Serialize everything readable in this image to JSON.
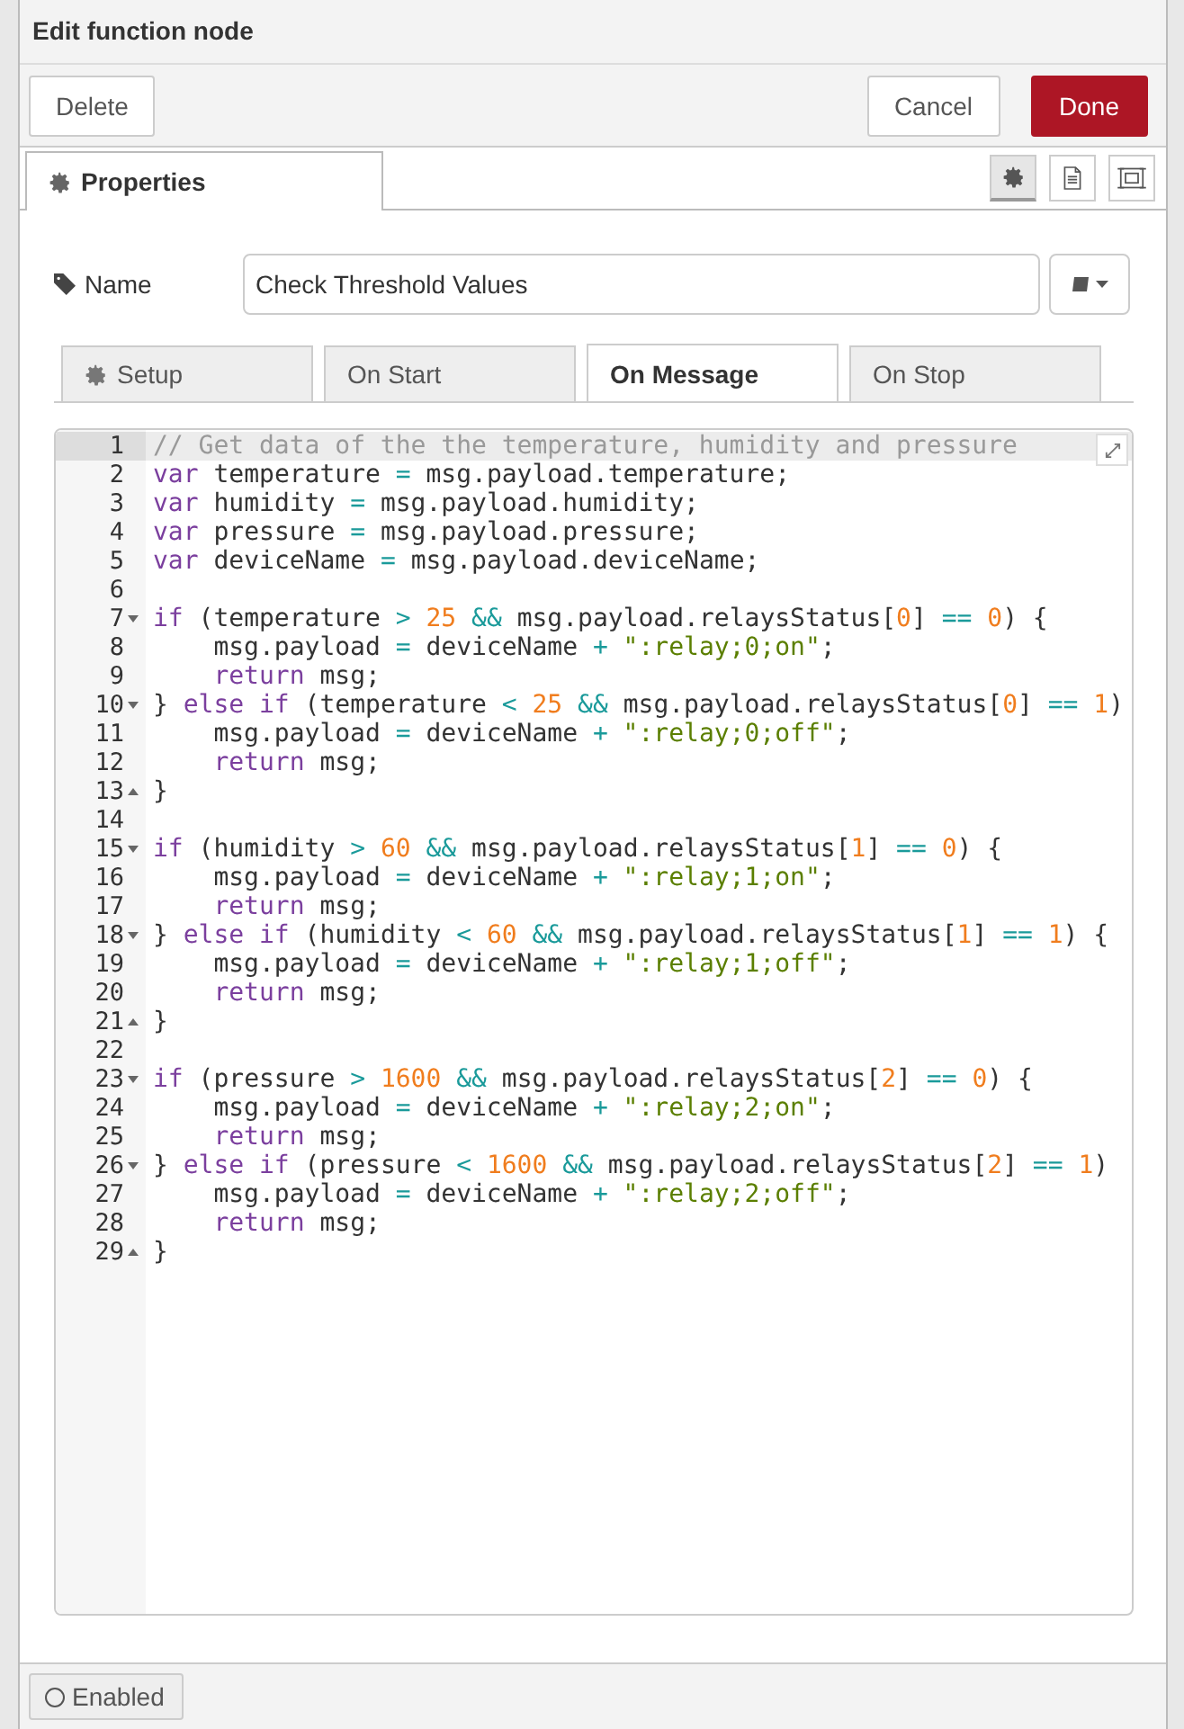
{
  "window": {
    "title": "Edit function node"
  },
  "toolbar": {
    "buttons": [
      {
        "label": "Delete",
        "kind": "plain"
      },
      {
        "label": "Cancel",
        "kind": "plain"
      },
      {
        "label": "Done",
        "kind": "primary"
      }
    ]
  },
  "tabs": [
    {
      "label": "Properties",
      "selected": true
    }
  ],
  "tab_icons": [
    {
      "kind": "gear",
      "selected": true
    },
    {
      "kind": "document",
      "selected": false
    },
    {
      "kind": "frame",
      "selected": false
    }
  ],
  "name_field": {
    "label": "Name",
    "value": "Check Threshold Values"
  },
  "code_tabs": [
    {
      "label": "Setup",
      "selected": false
    },
    {
      "label": "On Start",
      "selected": false
    },
    {
      "label": "On Message",
      "selected": true
    },
    {
      "label": "On Stop",
      "selected": false
    }
  ],
  "editor": {
    "lines": [
      {
        "number": "1",
        "active": true,
        "tokens": [
          {
            "kind": "comment",
            "text": "// Get data of the the temperature, humidity and pressure"
          }
        ]
      },
      {
        "number": "2",
        "active": false,
        "tokens": [
          {
            "kind": "keyword",
            "text": "var"
          },
          {
            "kind": "plain",
            "text": " temperature "
          },
          {
            "kind": "operator",
            "text": "= "
          },
          {
            "kind": "plain",
            "text": "msg.payload.temperature;"
          }
        ]
      },
      {
        "number": "3",
        "active": false,
        "tokens": [
          {
            "kind": "keyword",
            "text": "var"
          },
          {
            "kind": "plain",
            "text": " humidity "
          },
          {
            "kind": "operator",
            "text": "= "
          },
          {
            "kind": "plain",
            "text": "msg.payload.humidity;"
          }
        ]
      },
      {
        "number": "4",
        "active": false,
        "tokens": [
          {
            "kind": "keyword",
            "text": "var"
          },
          {
            "kind": "plain",
            "text": " pressure "
          },
          {
            "kind": "operator",
            "text": "= "
          },
          {
            "kind": "plain",
            "text": "msg.payload.pressure;"
          }
        ]
      },
      {
        "number": "5",
        "active": false,
        "tokens": [
          {
            "kind": "keyword",
            "text": "var"
          },
          {
            "kind": "plain",
            "text": " deviceName "
          },
          {
            "kind": "operator",
            "text": "= "
          },
          {
            "kind": "plain",
            "text": "msg.payload.deviceName;"
          }
        ]
      },
      {
        "number": "6",
        "active": false
      },
      {
        "number": "7",
        "active": false,
        "fold_start": true,
        "tokens": [
          {
            "kind": "keyword",
            "text": "if"
          },
          {
            "kind": "plain",
            "text": " (temperature "
          },
          {
            "kind": "operator",
            "text": "> "
          },
          {
            "kind": "number",
            "text": "25 "
          },
          {
            "kind": "operator",
            "text": "&& "
          },
          {
            "kind": "plain",
            "text": "msg.payload.relaysStatus["
          },
          {
            "kind": "number",
            "text": "0"
          },
          {
            "kind": "plain",
            "text": "] "
          },
          {
            "kind": "operator",
            "text": "== "
          },
          {
            "kind": "number",
            "text": "0"
          },
          {
            "kind": "plain",
            "text": ") {"
          }
        ]
      },
      {
        "number": "8",
        "active": false,
        "indented": true,
        "tokens": [
          {
            "kind": "plain",
            "text": "msg.payload "
          },
          {
            "kind": "operator",
            "text": "= "
          },
          {
            "kind": "plain",
            "text": "deviceName "
          },
          {
            "kind": "operator",
            "text": "+ "
          },
          {
            "kind": "string",
            "text": "\":relay;0;on\""
          },
          {
            "kind": "plain",
            "text": ";"
          }
        ]
      },
      {
        "number": "9",
        "active": false,
        "indented": true,
        "tokens": [
          {
            "kind": "keyword",
            "text": "return"
          },
          {
            "kind": "plain",
            "text": " msg;"
          }
        ]
      },
      {
        "number": "10",
        "active": false,
        "fold_start": true,
        "tokens": [
          {
            "kind": "plain",
            "text": "} "
          },
          {
            "kind": "keyword",
            "text": "else if"
          },
          {
            "kind": "plain",
            "text": " (temperature "
          },
          {
            "kind": "operator",
            "text": "< "
          },
          {
            "kind": "number",
            "text": "25 "
          },
          {
            "kind": "operator",
            "text": "&& "
          },
          {
            "kind": "plain",
            "text": "msg.payload.relaysStatus["
          },
          {
            "kind": "number",
            "text": "0"
          },
          {
            "kind": "plain",
            "text": "] "
          },
          {
            "kind": "operator",
            "text": "== "
          },
          {
            "kind": "number",
            "text": "1"
          },
          {
            "kind": "plain",
            "text": ")"
          }
        ]
      },
      {
        "number": "11",
        "active": false,
        "indented": true,
        "tokens": [
          {
            "kind": "plain",
            "text": "msg.payload "
          },
          {
            "kind": "operator",
            "text": "= "
          },
          {
            "kind": "plain",
            "text": "deviceName "
          },
          {
            "kind": "operator",
            "text": "+ "
          },
          {
            "kind": "string",
            "text": "\":relay;0;off\""
          },
          {
            "kind": "plain",
            "text": ";"
          }
        ]
      },
      {
        "number": "12",
        "active": false,
        "indented": true,
        "tokens": [
          {
            "kind": "keyword",
            "text": "return"
          },
          {
            "kind": "plain",
            "text": " msg;"
          }
        ]
      },
      {
        "number": "13",
        "active": false,
        "fold_end": true,
        "tokens": [
          {
            "kind": "plain",
            "text": "}"
          }
        ]
      },
      {
        "number": "14",
        "active": false
      },
      {
        "number": "15",
        "active": false,
        "fold_start": true,
        "tokens": [
          {
            "kind": "keyword",
            "text": "if"
          },
          {
            "kind": "plain",
            "text": " (humidity "
          },
          {
            "kind": "operator",
            "text": "> "
          },
          {
            "kind": "number",
            "text": "60 "
          },
          {
            "kind": "operator",
            "text": "&& "
          },
          {
            "kind": "plain",
            "text": "msg.payload.relaysStatus["
          },
          {
            "kind": "number",
            "text": "1"
          },
          {
            "kind": "plain",
            "text": "] "
          },
          {
            "kind": "operator",
            "text": "== "
          },
          {
            "kind": "number",
            "text": "0"
          },
          {
            "kind": "plain",
            "text": ") {"
          }
        ]
      },
      {
        "number": "16",
        "active": false,
        "indented": true,
        "tokens": [
          {
            "kind": "plain",
            "text": "msg.payload "
          },
          {
            "kind": "operator",
            "text": "= "
          },
          {
            "kind": "plain",
            "text": "deviceName "
          },
          {
            "kind": "operator",
            "text": "+ "
          },
          {
            "kind": "string",
            "text": "\":relay;1;on\""
          },
          {
            "kind": "plain",
            "text": ";"
          }
        ]
      },
      {
        "number": "17",
        "active": false,
        "indented": true,
        "tokens": [
          {
            "kind": "keyword",
            "text": "return"
          },
          {
            "kind": "plain",
            "text": " msg;"
          }
        ]
      },
      {
        "number": "18",
        "active": false,
        "fold_start": true,
        "tokens": [
          {
            "kind": "plain",
            "text": "} "
          },
          {
            "kind": "keyword",
            "text": "else if"
          },
          {
            "kind": "plain",
            "text": " (humidity "
          },
          {
            "kind": "operator",
            "text": "< "
          },
          {
            "kind": "number",
            "text": "60 "
          },
          {
            "kind": "operator",
            "text": "&& "
          },
          {
            "kind": "plain",
            "text": "msg.payload.relaysStatus["
          },
          {
            "kind": "number",
            "text": "1"
          },
          {
            "kind": "plain",
            "text": "] "
          },
          {
            "kind": "operator",
            "text": "== "
          },
          {
            "kind": "number",
            "text": "1"
          },
          {
            "kind": "plain",
            "text": ") {"
          }
        ]
      },
      {
        "number": "19",
        "active": false,
        "indented": true,
        "tokens": [
          {
            "kind": "plain",
            "text": "msg.payload "
          },
          {
            "kind": "operator",
            "text": "= "
          },
          {
            "kind": "plain",
            "text": "deviceName "
          },
          {
            "kind": "operator",
            "text": "+ "
          },
          {
            "kind": "string",
            "text": "\":relay;1;off\""
          },
          {
            "kind": "plain",
            "text": ";"
          }
        ]
      },
      {
        "number": "20",
        "active": false,
        "indented": true,
        "tokens": [
          {
            "kind": "keyword",
            "text": "return"
          },
          {
            "kind": "plain",
            "text": " msg;"
          }
        ]
      },
      {
        "number": "21",
        "active": false,
        "fold_end": true,
        "tokens": [
          {
            "kind": "plain",
            "text": "}"
          }
        ]
      },
      {
        "number": "22",
        "active": false
      },
      {
        "number": "23",
        "active": false,
        "fold_start": true,
        "tokens": [
          {
            "kind": "keyword",
            "text": "if"
          },
          {
            "kind": "plain",
            "text": " (pressure "
          },
          {
            "kind": "operator",
            "text": "> "
          },
          {
            "kind": "number",
            "text": "1600 "
          },
          {
            "kind": "operator",
            "text": "&& "
          },
          {
            "kind": "plain",
            "text": "msg.payload.relaysStatus["
          },
          {
            "kind": "number",
            "text": "2"
          },
          {
            "kind": "plain",
            "text": "] "
          },
          {
            "kind": "operator",
            "text": "== "
          },
          {
            "kind": "number",
            "text": "0"
          },
          {
            "kind": "plain",
            "text": ") {"
          }
        ]
      },
      {
        "number": "24",
        "active": false,
        "indented": true,
        "tokens": [
          {
            "kind": "plain",
            "text": "msg.payload "
          },
          {
            "kind": "operator",
            "text": "= "
          },
          {
            "kind": "plain",
            "text": "deviceName "
          },
          {
            "kind": "operator",
            "text": "+ "
          },
          {
            "kind": "string",
            "text": "\":relay;2;on\""
          },
          {
            "kind": "plain",
            "text": ";"
          }
        ]
      },
      {
        "number": "25",
        "active": false,
        "indented": true,
        "tokens": [
          {
            "kind": "keyword",
            "text": "return"
          },
          {
            "kind": "plain",
            "text": " msg;"
          }
        ]
      },
      {
        "number": "26",
        "active": false,
        "fold_start": true,
        "tokens": [
          {
            "kind": "plain",
            "text": "} "
          },
          {
            "kind": "keyword",
            "text": "else if"
          },
          {
            "kind": "plain",
            "text": " (pressure "
          },
          {
            "kind": "operator",
            "text": "< "
          },
          {
            "kind": "number",
            "text": "1600 "
          },
          {
            "kind": "operator",
            "text": "&& "
          },
          {
            "kind": "plain",
            "text": "msg.payload.relaysStatus["
          },
          {
            "kind": "number",
            "text": "2"
          },
          {
            "kind": "plain",
            "text": "] "
          },
          {
            "kind": "operator",
            "text": "== "
          },
          {
            "kind": "number",
            "text": "1"
          },
          {
            "kind": "plain",
            "text": ")"
          }
        ]
      },
      {
        "number": "27",
        "active": false,
        "indented": true,
        "tokens": [
          {
            "kind": "plain",
            "text": "msg.payload "
          },
          {
            "kind": "operator",
            "text": "= "
          },
          {
            "kind": "plain",
            "text": "deviceName "
          },
          {
            "kind": "operator",
            "text": "+ "
          },
          {
            "kind": "string",
            "text": "\":relay;2;off\""
          },
          {
            "kind": "plain",
            "text": ";"
          }
        ]
      },
      {
        "number": "28",
        "active": false,
        "indented": true,
        "tokens": [
          {
            "kind": "keyword",
            "text": "return"
          },
          {
            "kind": "plain",
            "text": " msg;"
          }
        ]
      },
      {
        "number": "29",
        "active": false,
        "fold_end": true,
        "tokens": [
          {
            "kind": "plain",
            "text": "}"
          }
        ]
      }
    ]
  },
  "footer": {
    "enabled_label": "Enabled",
    "enabled": false
  }
}
